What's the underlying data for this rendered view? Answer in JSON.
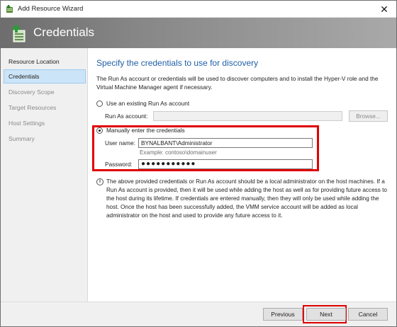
{
  "window": {
    "title": "Add Resource Wizard",
    "close_glyph": "✕"
  },
  "banner": {
    "title": "Credentials"
  },
  "nav": {
    "items": [
      {
        "label": "Resource Location",
        "state": "done"
      },
      {
        "label": "Credentials",
        "state": "active"
      },
      {
        "label": "Discovery Scope",
        "state": "pending"
      },
      {
        "label": "Target Resources",
        "state": "pending"
      },
      {
        "label": "Host Settings",
        "state": "pending"
      },
      {
        "label": "Summary",
        "state": "pending"
      }
    ]
  },
  "main": {
    "heading": "Specify the credentials to use for discovery",
    "intro": "The Run As account or credentials will be used to discover computers and to install the Hyper-V role and the Virtual Machine Manager agent if necessary.",
    "option_existing": {
      "label": "Use an existing Run As account",
      "selected": false,
      "field_label": "Run As account:",
      "field_value": "",
      "browse_label": "Browse..."
    },
    "option_manual": {
      "label": "Manually enter the credentials",
      "selected": true,
      "username_label": "User name:",
      "username_value": "BYNALBANT\\Administrator",
      "example": "Example: contoso\\domainuser",
      "password_label": "Password:",
      "password_value": "●●●●●●●●●●●"
    },
    "info_icon_glyph": "i",
    "info_text": "The above provided credentials or Run As account should be a local administrator on the host machines. If a Run As account is provided, then it will be used while adding the host as well as for providing future access to the host during its lifetime. If credentials are entered manually, then they will only be used while adding the host. Once the host has been successfully added, the VMM service account will be added as local administrator on the host and used to provide any future access to it."
  },
  "footer": {
    "previous_label": "Previous",
    "next_label": "Next",
    "cancel_label": "Cancel"
  },
  "colors": {
    "highlight": "#e00000",
    "heading_blue": "#1f5fa6",
    "nav_active_bg": "#cce4f7"
  },
  "icons": {
    "title": "wizard-add-icon",
    "banner": "add-resource-icon",
    "info": "info-icon"
  }
}
